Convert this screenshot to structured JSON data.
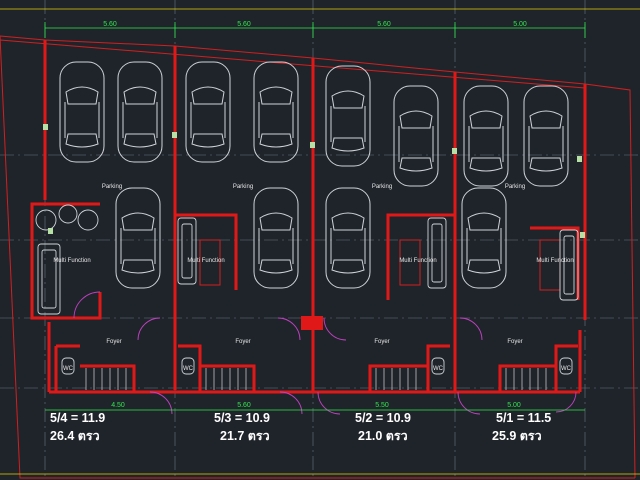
{
  "dimensions": {
    "top": [
      "5.60",
      "5.60",
      "5.60",
      "5.00"
    ],
    "bottom": [
      "4.50",
      "5.60",
      "5.50",
      "5.00"
    ]
  },
  "units": [
    {
      "parking": "Parking",
      "multi": "Multi Function",
      "foyer": "Foyer",
      "wc": "WC",
      "area_line1": "5/4 = 11.9",
      "area_line2": "26.4 ตรว"
    },
    {
      "parking": "Parking",
      "multi": "Multi Function",
      "foyer": "Foyer",
      "wc": "WC",
      "area_line1": "5/3 = 10.9",
      "area_line2": "21.7 ตรว"
    },
    {
      "parking": "Parking",
      "multi": "Multi Function",
      "foyer": "Foyer",
      "wc": "WC",
      "area_line1": "5/2 = 10.9",
      "area_line2": "21.0 ตรว"
    },
    {
      "parking": "Parking",
      "multi": "Multi Function",
      "foyer": "Foyer",
      "wc": "WC",
      "area_line1": "5/1 = 11.5",
      "area_line2": "25.9 ตรว"
    }
  ],
  "colors": {
    "background": "#1f242b",
    "wall": "#e01818",
    "dimension": "#2ee84a",
    "car": "#cfd3d8",
    "door": "#c040c0"
  }
}
